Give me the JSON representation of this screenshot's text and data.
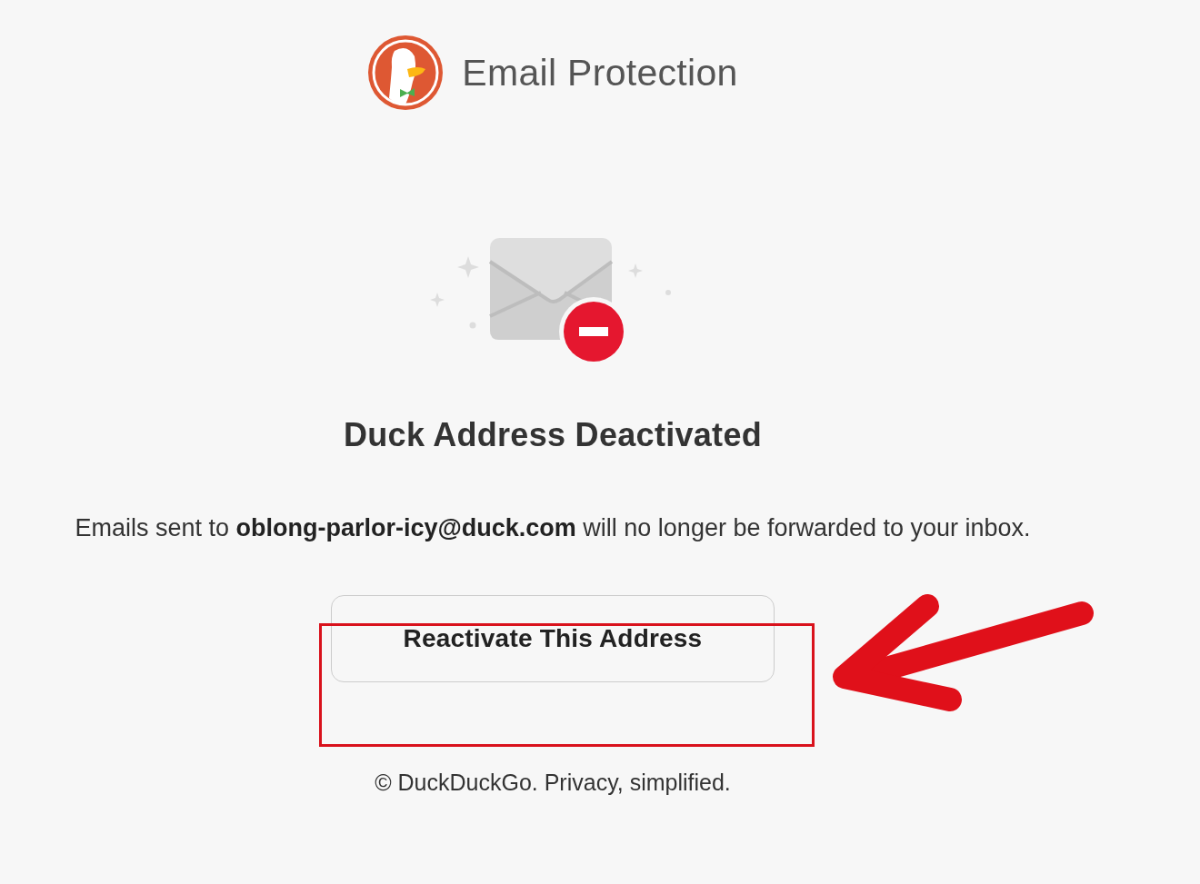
{
  "header": {
    "title": "Email Protection"
  },
  "notice": {
    "heading": "Duck Address Deactivated",
    "message": "Emails sent to **oblong-parlor-icy@duck.com** will no longer be forwarded to your inbox.",
    "button": "Reactivate This Address"
  },
  "footer": {
    "text": "© DuckDuckGo. Privacy, simplified."
  }
}
